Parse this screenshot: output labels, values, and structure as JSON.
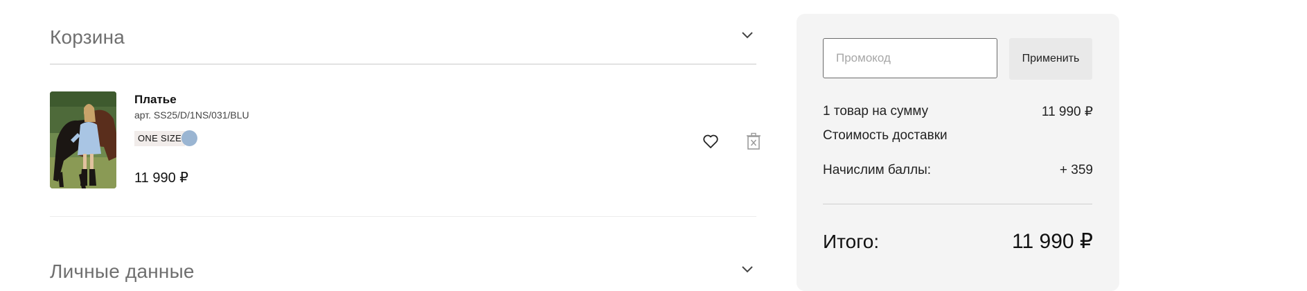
{
  "cart": {
    "title": "Корзина",
    "item": {
      "name": "Платье",
      "sku": "арт. SS25/D/1NS/031/BLU",
      "size": "ONE SIZE",
      "color_swatch": "#9ab5d2",
      "price": "11 990 ₽"
    }
  },
  "personal": {
    "title": "Личные данные"
  },
  "summary": {
    "promo_placeholder": "Промокод",
    "apply_label": "Применить",
    "items_label": "1 товар на сумму",
    "items_value": "11 990 ₽",
    "delivery_label": "Стоимость доставки",
    "points_label": "Начислим баллы:",
    "points_value": "+ 359",
    "total_label": "Итого:",
    "total_value": "11 990 ₽"
  },
  "icons": {
    "expand": "chevron-down-icon",
    "favorite": "heart-icon",
    "delete": "trash-icon"
  }
}
